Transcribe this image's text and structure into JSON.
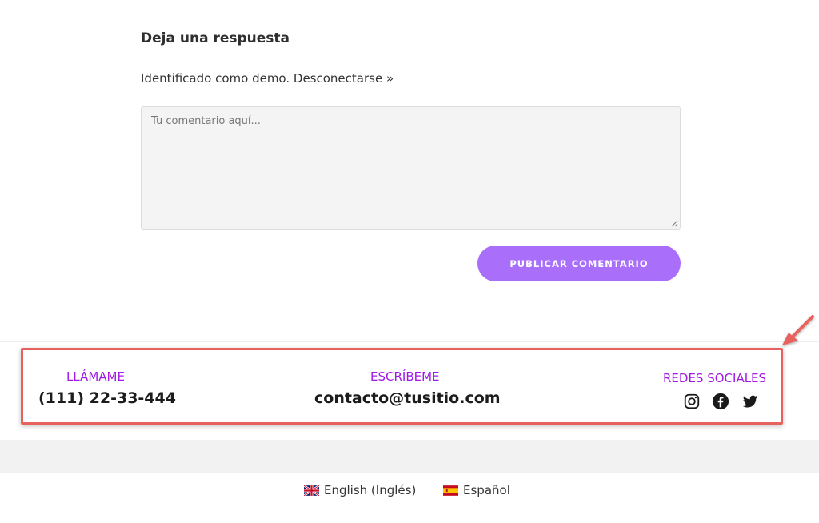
{
  "comments": {
    "reply_title": "Deja una respuesta",
    "logged_in_prefix": "Identificado como demo. ",
    "logout_link": "Desconectarse »",
    "textarea_placeholder": "Tu comentario aquí...",
    "submit_label": "PUBLICAR COMENTARIO"
  },
  "footer": {
    "call": {
      "label": "LLÁMAME",
      "value": "(111) 22-33-444"
    },
    "email": {
      "label": "ESCRÍBEME",
      "value": "contacto@tusitio.com"
    },
    "social": {
      "label": "REDES SOCIALES",
      "icons": [
        "instagram-icon",
        "facebook-icon",
        "twitter-icon"
      ]
    }
  },
  "languages": [
    {
      "name": "English (Inglés)",
      "flag": "uk-flag-icon"
    },
    {
      "name": "Español",
      "flag": "spain-flag-icon"
    }
  ],
  "colors": {
    "accent": "#a96ffb",
    "label_purple": "#a119e6",
    "highlight_border": "#e8625d"
  }
}
